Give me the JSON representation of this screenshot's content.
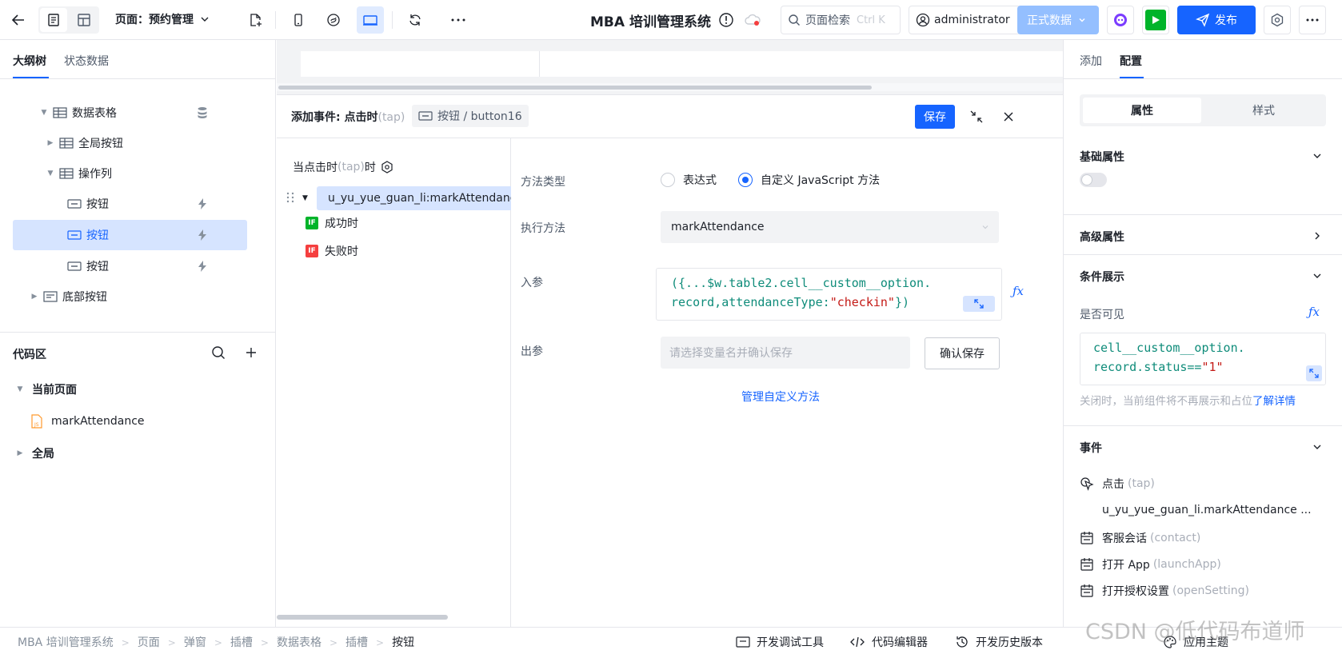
{
  "topbar": {
    "page_label": "页面：预约管理",
    "app_title": "MBA 培训管理系统",
    "search_placeholder": "页面检索",
    "search_shortcut": "Ctrl K",
    "user": "administrator",
    "env_label": "正式数据",
    "publish_label": "发布"
  },
  "left": {
    "tabs": [
      "大纲树",
      "状态数据"
    ],
    "tree": {
      "data_table": "数据表格",
      "global_buttons": "全局按钮",
      "action_column": "操作列",
      "button_1": "按钮",
      "button_2": "按钮",
      "button_3": "按钮",
      "bottom_buttons": "底部按钮"
    },
    "code": {
      "title": "代码区",
      "current_page": "当前页面",
      "file": "markAttendance",
      "global": "全局"
    }
  },
  "event_panel": {
    "title": "添加事件: 点击时",
    "title_suffix": "(tap)",
    "target": "按钮 / button16",
    "save_label": "保存",
    "trigger_label": "当点击时",
    "trigger_suffix": "(tap)",
    "trigger_tail": "时",
    "action_item": "u_yu_yue_guan_li:markAttendance",
    "success_label": "成功时",
    "fail_label": "失败时",
    "if_badge": "IF",
    "method_type_label": "方法类型",
    "radio_expression": "表达式",
    "radio_custom": "自定义 JavaScript 方法",
    "exec_method_label": "执行方法",
    "exec_method_value": "markAttendance",
    "input_params_label": "入参",
    "code_line1": "({...$w.table2.cell__custom__option.",
    "code_line2_a": "record,attendanceType:",
    "code_line2_str": "\"checkin\"",
    "code_line2_b": "})",
    "output_params_label": "出参",
    "output_placeholder": "请选择变量名并确认保存",
    "confirm_save_label": "确认保存",
    "manage_link": "管理自定义方法"
  },
  "right": {
    "tabs": [
      "添加",
      "配置"
    ],
    "seg": [
      "属性",
      "样式"
    ],
    "basic_props": "基础属性",
    "advanced_props": "高级属性",
    "conditional_display": "条件展示",
    "visible_label": "是否可见",
    "fx_label": "ƒx",
    "cond_code_1": "cell__custom__option.",
    "cond_code_2_a": "record.status==",
    "cond_code_2_str": "\"1\"",
    "hint": "关闭时，当前组件将不再展示和占位",
    "hint_link": "了解详情",
    "events_title": "事件",
    "events": [
      {
        "name": "点击",
        "code": "(tap)"
      },
      {
        "name": "客服会话",
        "code": "(contact)"
      },
      {
        "name": "打开 App",
        "code": "(launchApp)"
      },
      {
        "name": "打开授权设置",
        "code": "(openSetting)"
      }
    ],
    "tap_action": "u_yu_yue_guan_li.markAttendance ..."
  },
  "footer": {
    "breadcrumb": [
      "MBA 培训管理系统",
      "页面",
      "弹窗",
      "插槽",
      "数据表格",
      "插槽",
      "按钮"
    ],
    "dev_tools": "开发调试工具",
    "code_editor": "代码编辑器",
    "history": "开发历史版本",
    "theme": "应用主题"
  },
  "watermark": "CSDN @低代码布道师"
}
